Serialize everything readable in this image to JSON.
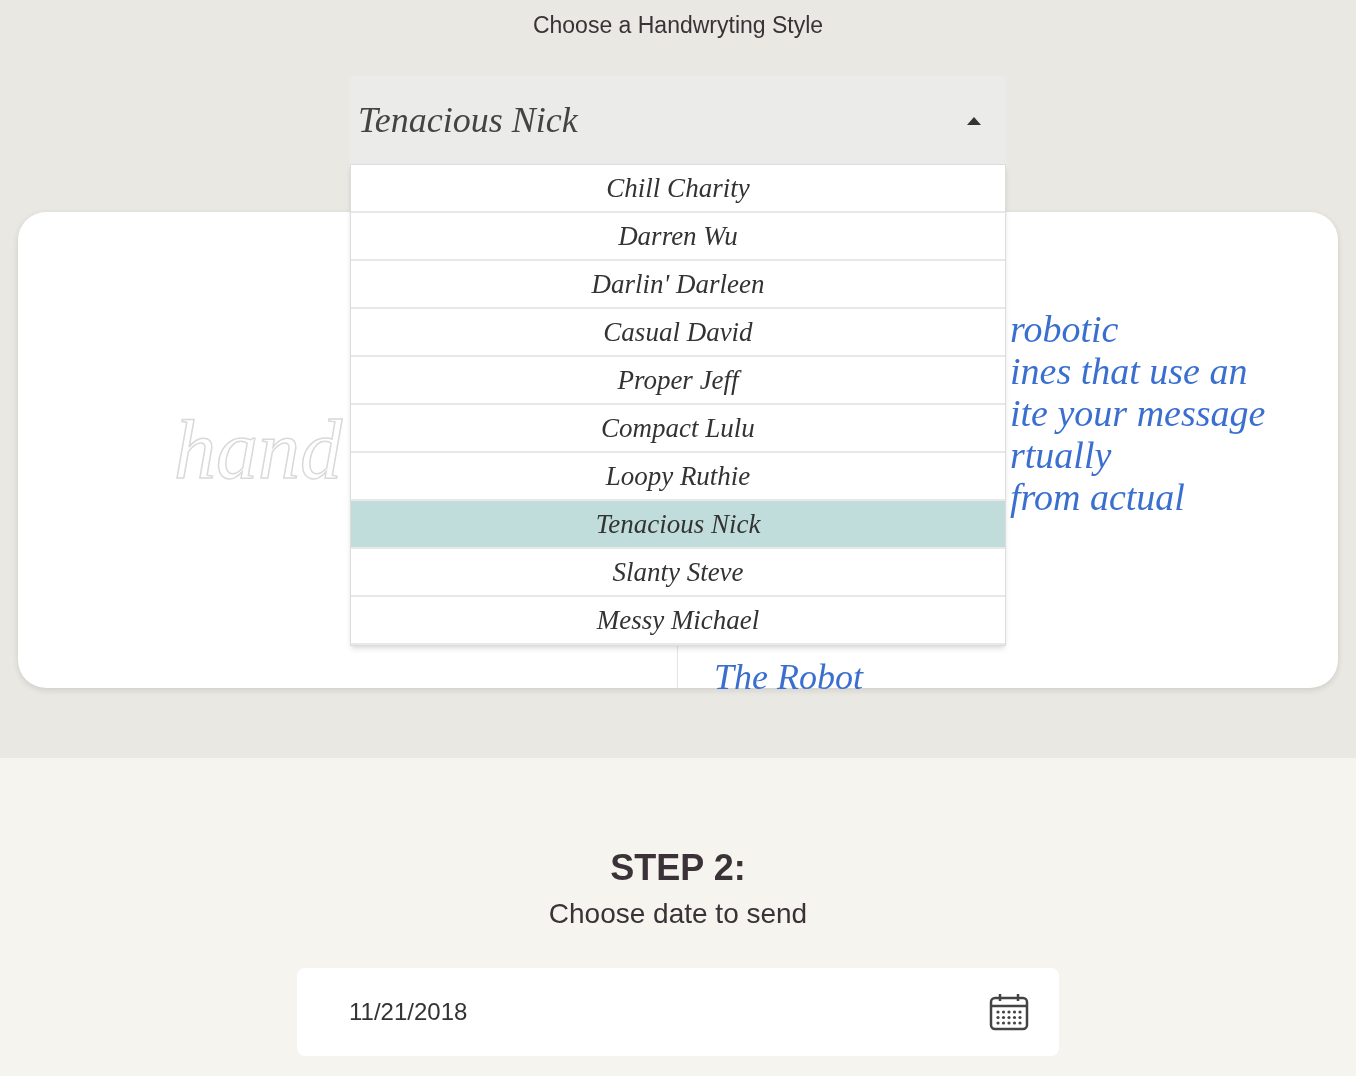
{
  "heading": "Choose a Handwryting Style",
  "style_select": {
    "value": "Tenacious Nick",
    "expanded": true,
    "options": [
      {
        "label": "Chill Charity",
        "selected": false
      },
      {
        "label": "Darren Wu",
        "selected": false
      },
      {
        "label": "Darlin' Darleen",
        "selected": false
      },
      {
        "label": "Casual David",
        "selected": false
      },
      {
        "label": "Proper Jeff",
        "selected": false
      },
      {
        "label": "Compact Lulu",
        "selected": false
      },
      {
        "label": "Loopy Ruthie",
        "selected": false
      },
      {
        "label": "Tenacious Nick",
        "selected": true
      },
      {
        "label": "Slanty Steve",
        "selected": false
      },
      {
        "label": "Messy Michael",
        "selected": false
      }
    ]
  },
  "preview_card": {
    "left_text": "hand",
    "right_lines": [
      "robotic",
      "ines that use an",
      "ite your message",
      "rtually",
      "from actual"
    ],
    "signature": "The Robot"
  },
  "step": {
    "title": "STEP 2:",
    "subtitle": "Choose date to send"
  },
  "date_field": {
    "value": "11/21/2018"
  }
}
